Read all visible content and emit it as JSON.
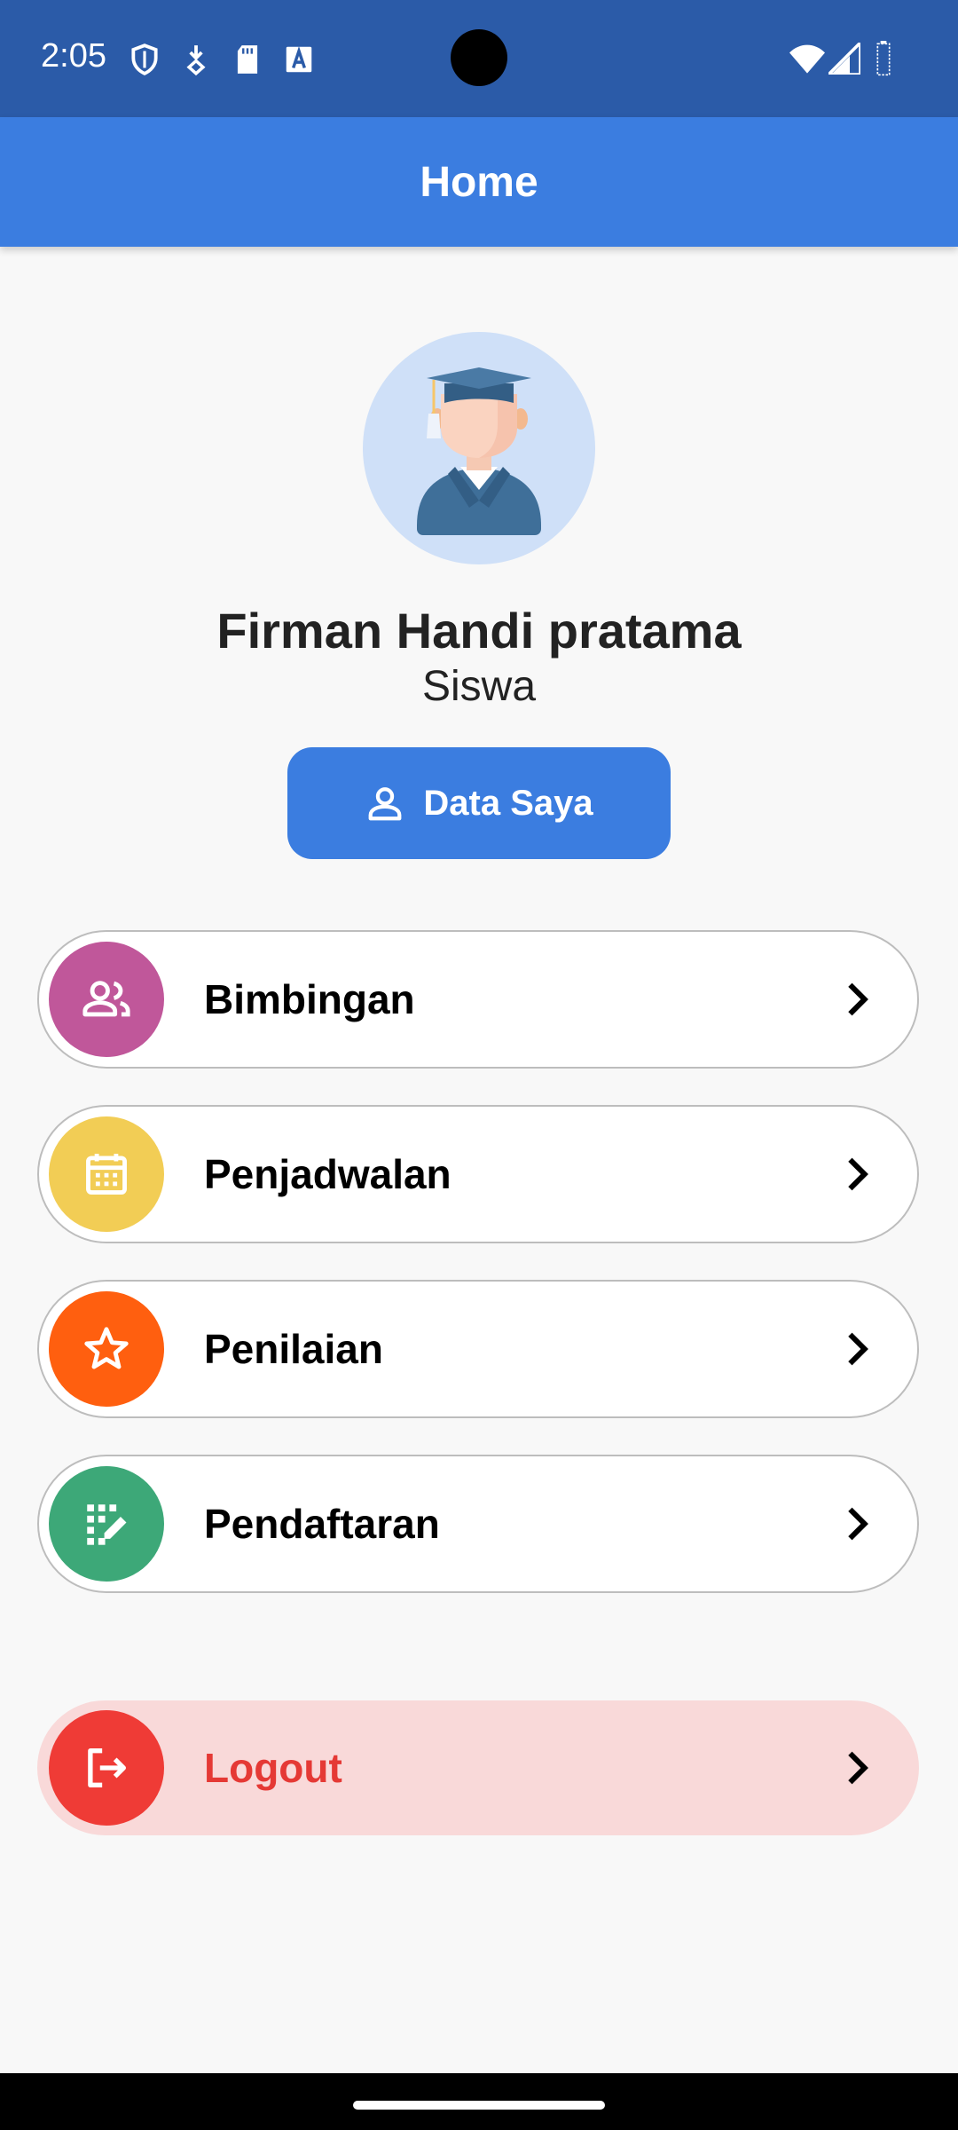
{
  "status_bar": {
    "time": "2:05"
  },
  "app_bar": {
    "title": "Home"
  },
  "profile": {
    "name": "Firman Handi pratama",
    "role": "Siswa",
    "data_button_label": "Data Saya"
  },
  "menu": [
    {
      "label": "Bimbingan",
      "icon": "group-icon",
      "color": "#c0579a"
    },
    {
      "label": "Penjadwalan",
      "icon": "calendar-icon",
      "color": "#f2cd55"
    },
    {
      "label": "Penilaian",
      "icon": "star-icon",
      "color": "#ff5f0f"
    },
    {
      "label": "Pendaftaran",
      "icon": "registration-icon",
      "color": "#3da878"
    }
  ],
  "logout": {
    "label": "Logout",
    "icon": "logout-icon",
    "color": "#ef3b36",
    "label_color": "#e53935",
    "background": "#f9d9d9"
  },
  "colors": {
    "app_bar": "#3b7de0",
    "status_bar": "#2b5ba8",
    "avatar_bg": "#cfe0f8"
  }
}
